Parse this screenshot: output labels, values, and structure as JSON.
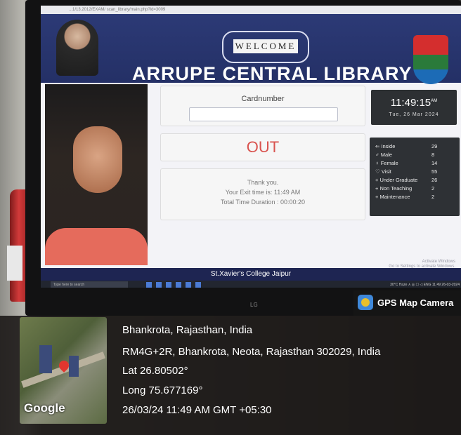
{
  "browser": {
    "url": "...1/13.2012/EXAM/ scan_library/main.php?id=3009"
  },
  "banner": {
    "welcome": "WELCOME",
    "title": "ARRUPE CENTRAL LIBRARY"
  },
  "card": {
    "label": "Cardnumber",
    "value": ""
  },
  "status": {
    "text": "OUT"
  },
  "message": {
    "thanks": "Thank you.",
    "exit": "Your Exit time is: 11:49 AM",
    "duration": "Total Time Duration : 00:00:20"
  },
  "clock": {
    "time": "11:49:15",
    "meridiem": "AM",
    "date": "Tue, 26 Mar 2024"
  },
  "stats": [
    {
      "label": "Inside",
      "value": "29",
      "icon": "sign-in-icon"
    },
    {
      "label": "Male",
      "value": "8",
      "icon": "male-icon"
    },
    {
      "label": "Female",
      "value": "14",
      "icon": "female-icon"
    },
    {
      "label": "Visit",
      "value": "55",
      "icon": "visit-icon"
    },
    {
      "label": "Under Graduate",
      "value": "26",
      "icon": "plus-icon"
    },
    {
      "label": "Non Teaching",
      "value": "2",
      "icon": "plus-icon"
    },
    {
      "label": "Maintenance",
      "value": "2",
      "icon": "plus-icon"
    }
  ],
  "activate": {
    "line1": "Activate Windows",
    "line2": "Go to Settings to activate Windows."
  },
  "footer": {
    "text": "St.Xavier's College Jaipur"
  },
  "taskbar": {
    "search_placeholder": "Type here to search",
    "tray": "30°C Haze  ∧ ◎ ☐ ◁ ENG  11:49  26-03-2024"
  },
  "monitor": {
    "brand": "LG"
  },
  "gps": {
    "app_name": "GPS Map Camera",
    "location": "Bhankrota, Rajasthan, India",
    "address": "RM4G+2R, Bhankrota, Neota, Rajasthan 302029, India",
    "lat": "Lat 26.80502°",
    "long": "Long 75.677169°",
    "datetime": "26/03/24 11:49 AM GMT +05:30",
    "map_brand": "Google"
  },
  "colors": {
    "banner": "#2c3a76",
    "status_red": "#d9534f",
    "footer": "#1e2552",
    "panel_dark": "#2e3135"
  }
}
